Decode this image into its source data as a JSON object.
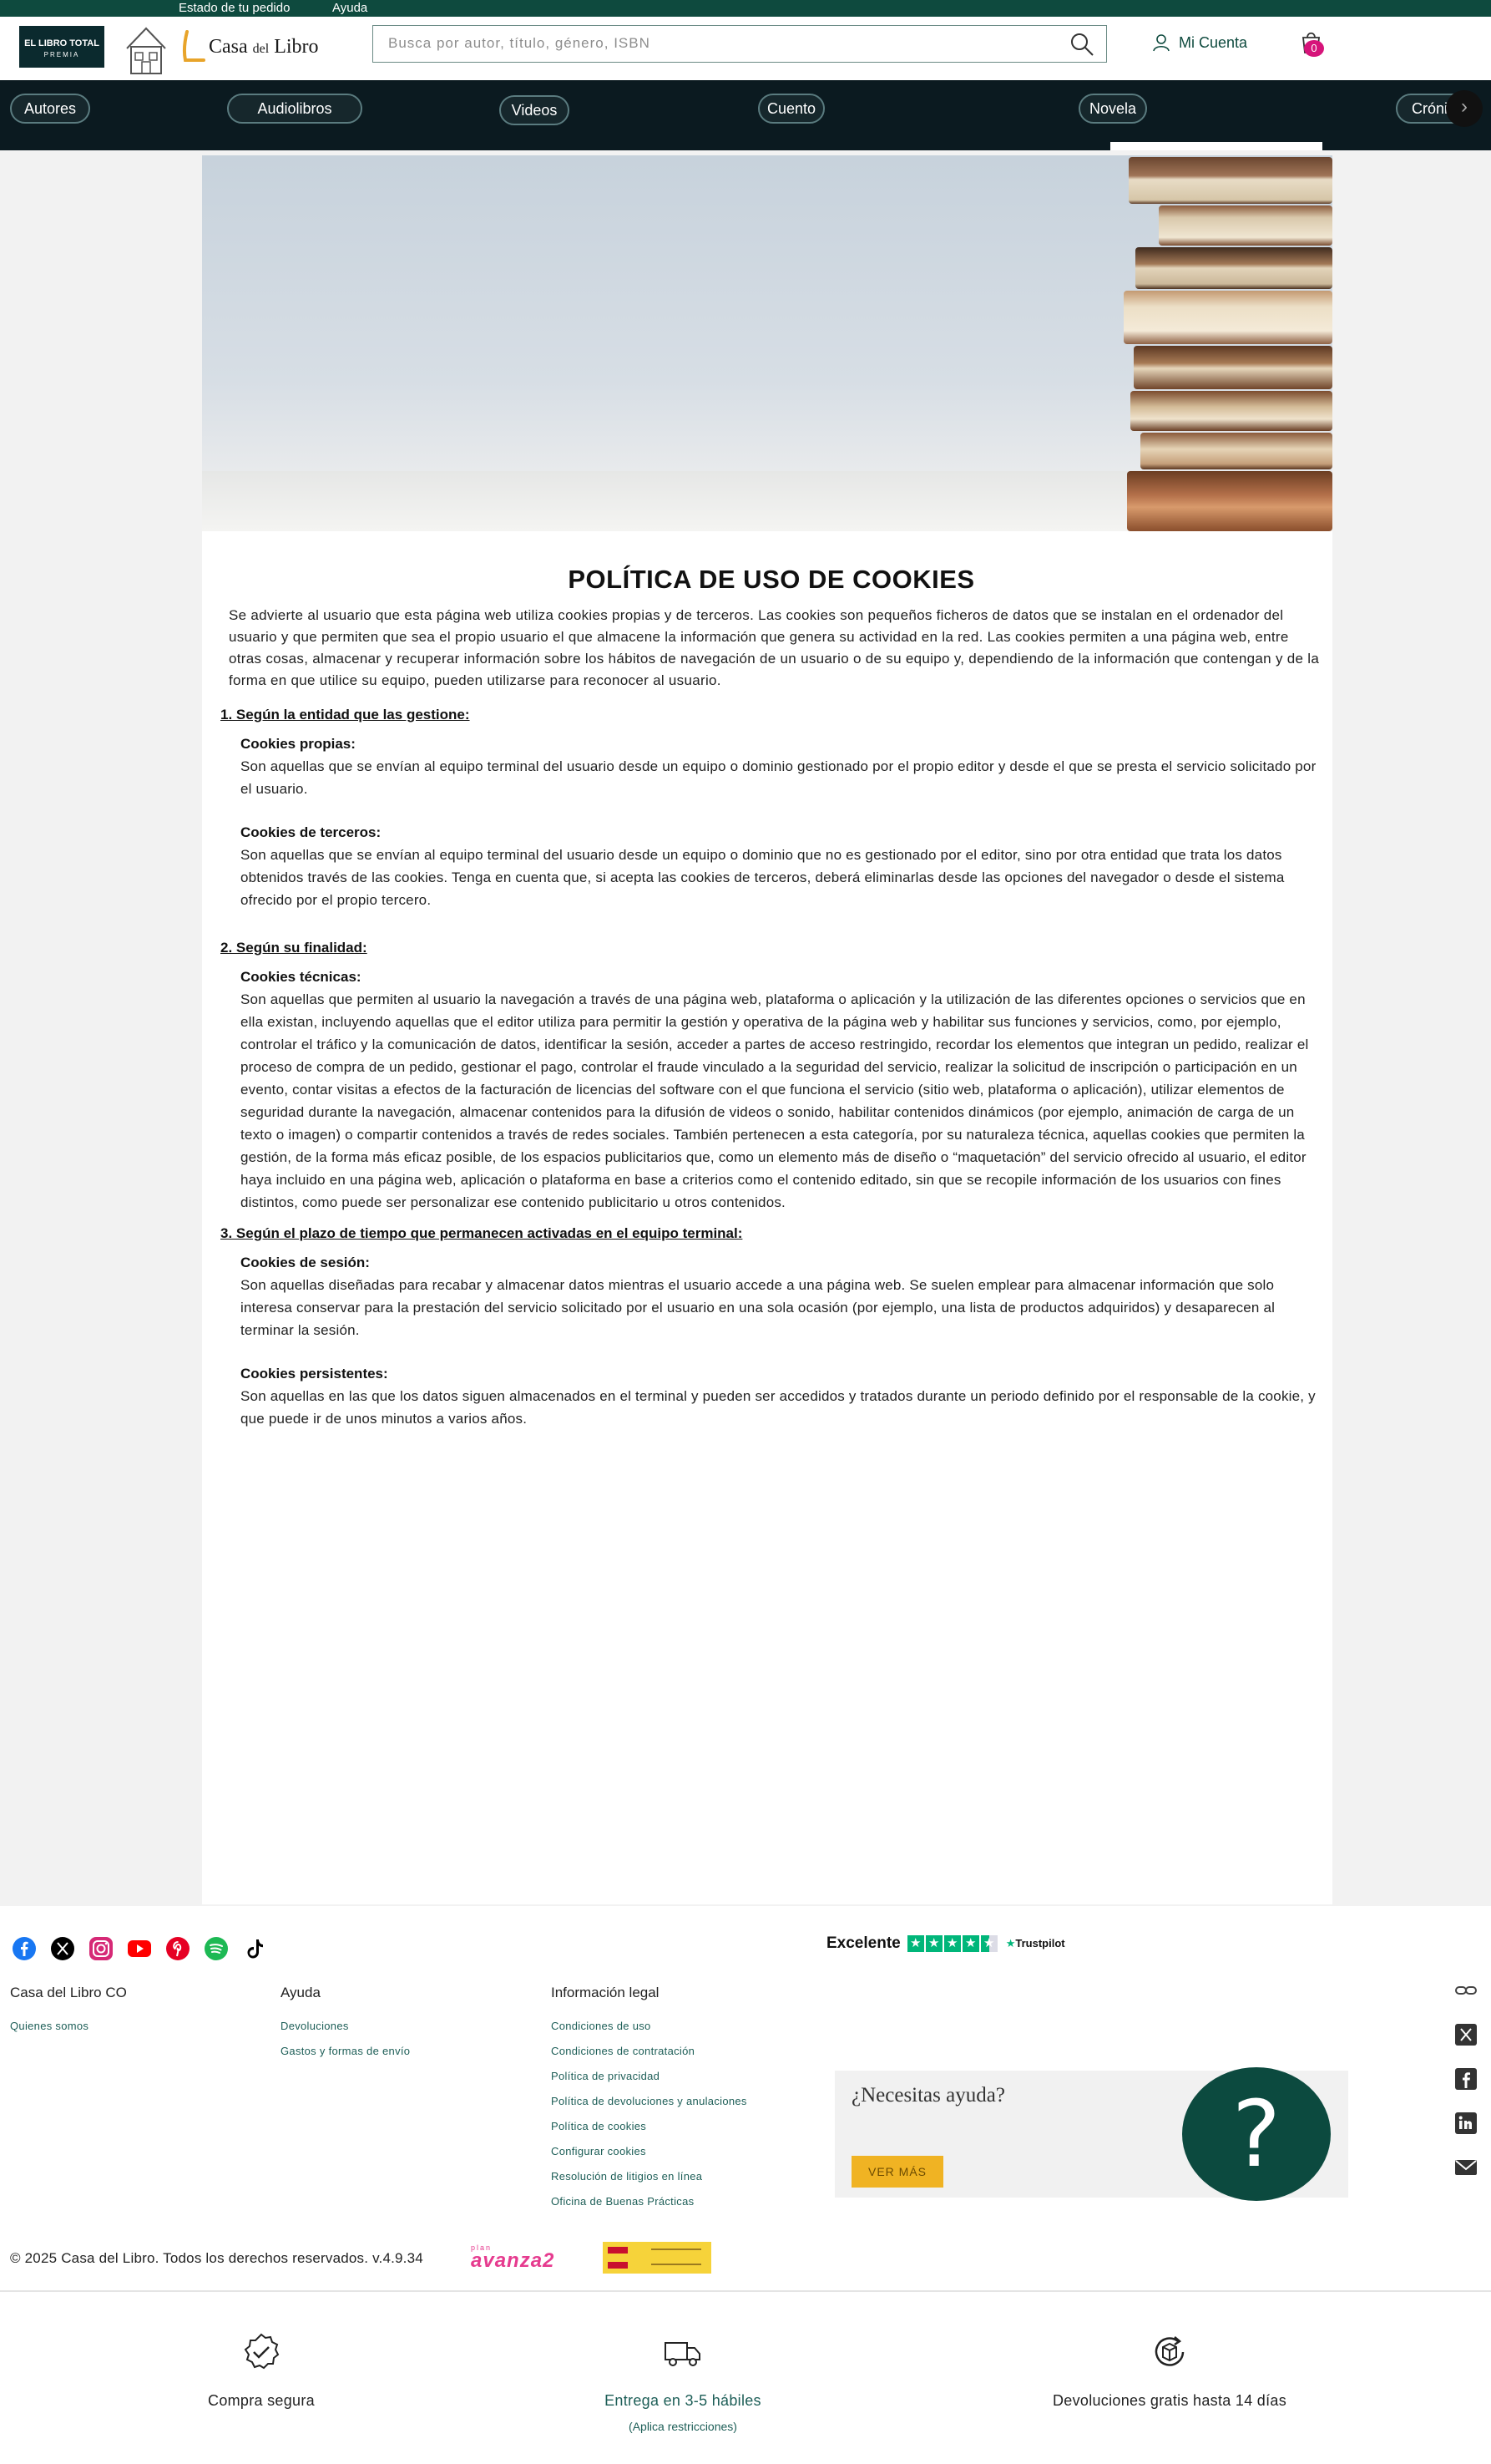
{
  "utility": {
    "order_status": "Estado de tu pedido",
    "help": "Ayuda"
  },
  "header": {
    "badge_line1": "EL LIBRO TOTAL",
    "badge_line2": "PREMIA",
    "logo_name": "Casa",
    "logo_del": "del",
    "logo_libro": "Libro",
    "search_placeholder": "Busca por autor, título, género, ISBN",
    "account_label": "Mi Cuenta",
    "cart_count": "0"
  },
  "nav": {
    "categories": [
      "Autores",
      "Audiolibros",
      "Videos",
      "Cuento",
      "Novela",
      "Crónica"
    ],
    "next_arrow": "›"
  },
  "content": {
    "title": "POLÍTICA DE USO DE COOKIES",
    "intro": "Se advierte al usuario que esta página web utiliza cookies propias y de terceros. Las cookies son pequeños ficheros de datos que se instalan en el ordenador del usuario y que permiten que sea el propio usuario el que almacene la información que genera su actividad en la red. Las cookies permiten a una página web, entre otras cosas, almacenar y recuperar información sobre los hábitos de navegación de un usuario o de su equipo y, dependiendo de la información que contengan y de la forma en que utilice su equipo, pueden utilizarse para reconocer al usuario.",
    "sections": [
      {
        "title": "1. Según la entidad que las gestione:",
        "items": [
          {
            "title": "Cookies propias:",
            "body": "Son aquellas que se envían al equipo terminal del usuario desde un equipo o dominio gestionado por el propio editor y desde el que se presta el servicio solicitado por el usuario."
          },
          {
            "title": "Cookies de terceros:",
            "body": "Son aquellas que se envían al equipo terminal del usuario desde un equipo o dominio que no es gestionado por el editor, sino por otra entidad que trata los datos obtenidos través de las cookies. Tenga en cuenta que, si acepta las cookies de terceros, deberá eliminarlas desde las opciones del navegador o desde el sistema ofrecido por el propio tercero."
          }
        ]
      },
      {
        "title": "2. Según su finalidad:",
        "items": [
          {
            "title": "Cookies técnicas:",
            "body": "Son aquellas que permiten al usuario la navegación a través de una página web, plataforma o aplicación y la utilización de las diferentes opciones o servicios que en ella existan, incluyendo aquellas que el editor utiliza para permitir la gestión y operativa de la página web y habilitar sus funciones y servicios, como, por ejemplo, controlar el tráfico y la comunicación de datos, identificar la sesión, acceder a partes de acceso restringido, recordar los elementos que integran un pedido, realizar el proceso de compra de un pedido, gestionar el pago, controlar el fraude vinculado a la seguridad del servicio, realizar la solicitud de inscripción o participación en un evento, contar visitas a efectos de la facturación de licencias del software con el que funciona el servicio (sitio web, plataforma o aplicación), utilizar elementos de seguridad durante la navegación, almacenar contenidos para la difusión de videos o sonido, habilitar contenidos dinámicos (por ejemplo, animación de carga de un texto o imagen) o compartir contenidos a través de redes sociales. También pertenecen a esta categoría, por su naturaleza técnica, aquellas cookies que permiten la gestión, de la forma más eficaz posible, de los espacios publicitarios que, como un elemento más de diseño o “maquetación” del servicio ofrecido al usuario, el editor haya incluido en una página web, aplicación o plataforma en base a criterios como el contenido editado, sin que se recopile información de los usuarios con fines distintos, como puede ser personalizar ese contenido publicitario u otros contenidos."
          }
        ]
      },
      {
        "title": "3. Según el plazo de tiempo que permanecen activadas en el equipo terminal:",
        "items": [
          {
            "title": "Cookies de sesión:",
            "body": "Son aquellas diseñadas para recabar y almacenar datos mientras el usuario accede a una página web. Se suelen emplear para almacenar información que solo interesa conservar para la prestación del servicio solicitado por el usuario en una sola ocasión (por ejemplo, una lista de productos adquiridos) y desaparecen al terminar la sesión."
          },
          {
            "title": "Cookies persistentes:",
            "body": "Son aquellas en las que los datos siguen almacenados en el terminal y pueden ser accedidos y tratados durante un periodo definido por el responsable de la cookie, y que puede ir de unos minutos a varios años."
          }
        ]
      }
    ]
  },
  "footer": {
    "trustpilot": {
      "rating_text": "Excelente",
      "brand": "Trustpilot",
      "star_glyph": "★"
    },
    "col1": {
      "title": "Casa del Libro CO",
      "links": [
        "Quienes somos"
      ]
    },
    "col2": {
      "title": "Ayuda",
      "links": [
        "Devoluciones",
        "Gastos y formas de envío"
      ]
    },
    "col3": {
      "title": "Información legal",
      "links": [
        "Condiciones de uso",
        "Condiciones de contratación",
        "Política de privacidad",
        "Política de devoluciones y anulaciones",
        "Política de cookies",
        "Configurar cookies",
        "Resolución de litigios en línea",
        "Oficina de Buenas Prácticas"
      ]
    },
    "help": {
      "title": "¿Necesitas ayuda?",
      "button": "VER MÁS",
      "glyph": "?"
    },
    "copyright": "© 2025 Casa del Libro. Todos los derechos reservados. v.4.9.34",
    "plan_avanza_top": "plan",
    "plan_avanza": "avanza2"
  },
  "trust": [
    {
      "label": "Compra segura",
      "sub": ""
    },
    {
      "label": "Entrega en 3-5 hábiles",
      "sub": "(Aplica restricciones)"
    },
    {
      "label": "Devoluciones gratis hasta 14 días",
      "sub": ""
    }
  ],
  "colors": {
    "brand_dark": "#0e4a3e",
    "nav_bg": "#0b1a20",
    "link": "#1d5e57",
    "accent_yellow": "#f0b323",
    "cart_badge": "#d6147a",
    "trustpilot_green": "#00b67a"
  }
}
